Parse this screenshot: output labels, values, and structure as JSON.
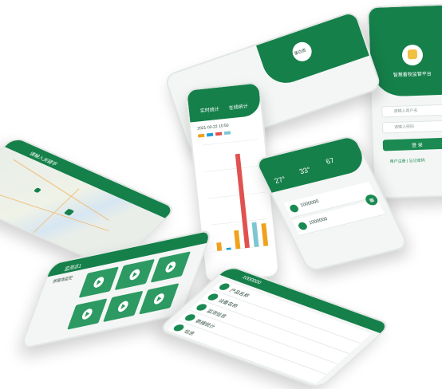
{
  "brand": {
    "primary": "#15804a",
    "accent_green": "#1a8a52",
    "bar_red": "#e0524f",
    "bar_orange": "#f0a21c"
  },
  "chart_phone": {
    "tab_left": "实时统计",
    "tab_right": "在线统计",
    "date_text": "2021-03-22 10:50",
    "legend": [
      "",
      "",
      "",
      "",
      ""
    ],
    "chart_data": {
      "type": "bar",
      "categories": [
        "",
        "",
        "",
        "",
        "",
        ""
      ],
      "values": [
        20,
        5,
        45,
        230,
        60,
        55
      ],
      "colors": [
        "#f0a21c",
        "#1aa0d8",
        "#f0a21c",
        "#e0524f",
        "#7dc7d3",
        "#f0a21c"
      ],
      "ylim": [
        0,
        260
      ]
    }
  },
  "map_phone": {
    "search_placeholder": "请输入关键字"
  },
  "top_phone": {
    "avatar_text": "蛋白质"
  },
  "login_phone": {
    "logo_text": "智慧畜牧监管平台",
    "user_placeholder": "请输入用户名",
    "pass_placeholder": "请输入密码",
    "login_label": "登 录",
    "footer_text": "用户注册 | 忘记密码"
  },
  "weather_phone": {
    "temps": [
      "27°",
      "33°",
      "67"
    ],
    "items": [
      {
        "title": "1000000",
        "tag": "在线"
      },
      {
        "title": "1000000",
        "tag": "在线"
      }
    ]
  },
  "video_phone": {
    "title": "监测点1",
    "sub": "养殖场监控"
  },
  "list_phone": {
    "title": "1000000",
    "items": [
      {
        "title": "产品名称"
      },
      {
        "title": "设备名称"
      },
      {
        "title": "监测信息"
      },
      {
        "title": "数据统计"
      },
      {
        "title": "信息"
      }
    ]
  }
}
